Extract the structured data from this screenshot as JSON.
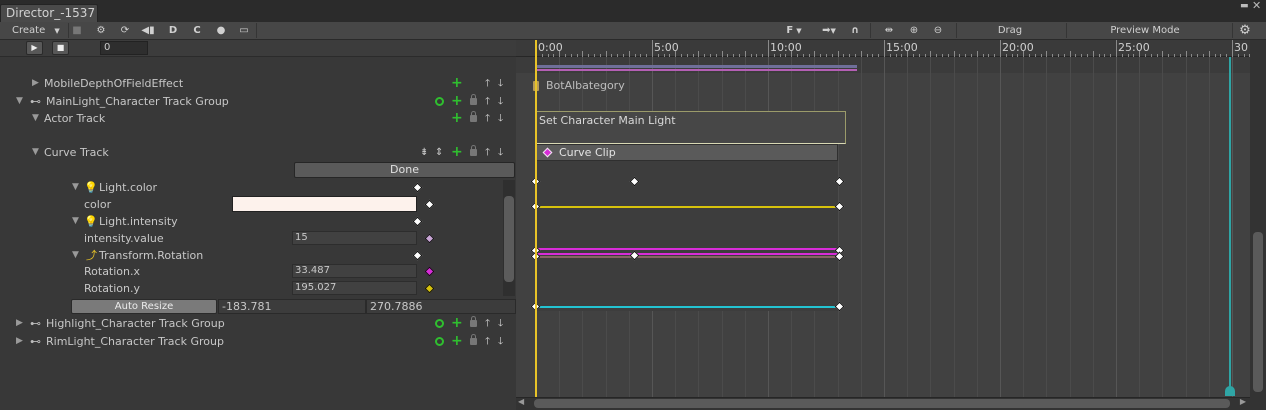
{
  "window": {
    "title": "Director_-1537"
  },
  "toolbar": {
    "create_label": "Create",
    "drag_label": "Drag",
    "preview_label": "Preview Mode",
    "f_label": "F"
  },
  "transport": {
    "frame_value": "0"
  },
  "ruler": {
    "labels": [
      "0:00",
      "5:00",
      "10:00",
      "15:00",
      "20:00",
      "25:00",
      "30"
    ]
  },
  "tracks": {
    "mobile_dof": "MobileDepthOfFieldEffect",
    "mainlight_group": "MainLight_Character Track Group",
    "actor_track": "Actor Track",
    "curve_track": "Curve Track",
    "done_label": "Done",
    "light_color": "Light.color",
    "color_label": "color",
    "light_intensity": "Light.intensity",
    "intensity_label": "intensity.value",
    "intensity_value": "15",
    "transform_rotation": "Transform.Rotation",
    "rotation_x_label": "Rotation.x",
    "rotation_x_value": "33.487",
    "rotation_y_label": "Rotation.y",
    "rotation_y_value": "195.027",
    "auto_resize_label": "Auto Resize",
    "range_min": "-183.781",
    "range_max": "270.7886",
    "highlight_group": "Highlight_Character Track Group",
    "rimlight_group": "RimLight_Character Track Group"
  },
  "timeline": {
    "event_text": "BotAlbategory",
    "actor_clip_label": "Set Character Main Light",
    "curve_clip_label": "Curve Clip"
  },
  "colors": {
    "playhead": "#e8c328",
    "end_marker": "#2fa5a5",
    "curve_yellow": "#d7c20c",
    "curve_magenta": "#d82cd8",
    "curve_cyan": "#23c3d2",
    "color_swatch": "#fdf2ec"
  }
}
